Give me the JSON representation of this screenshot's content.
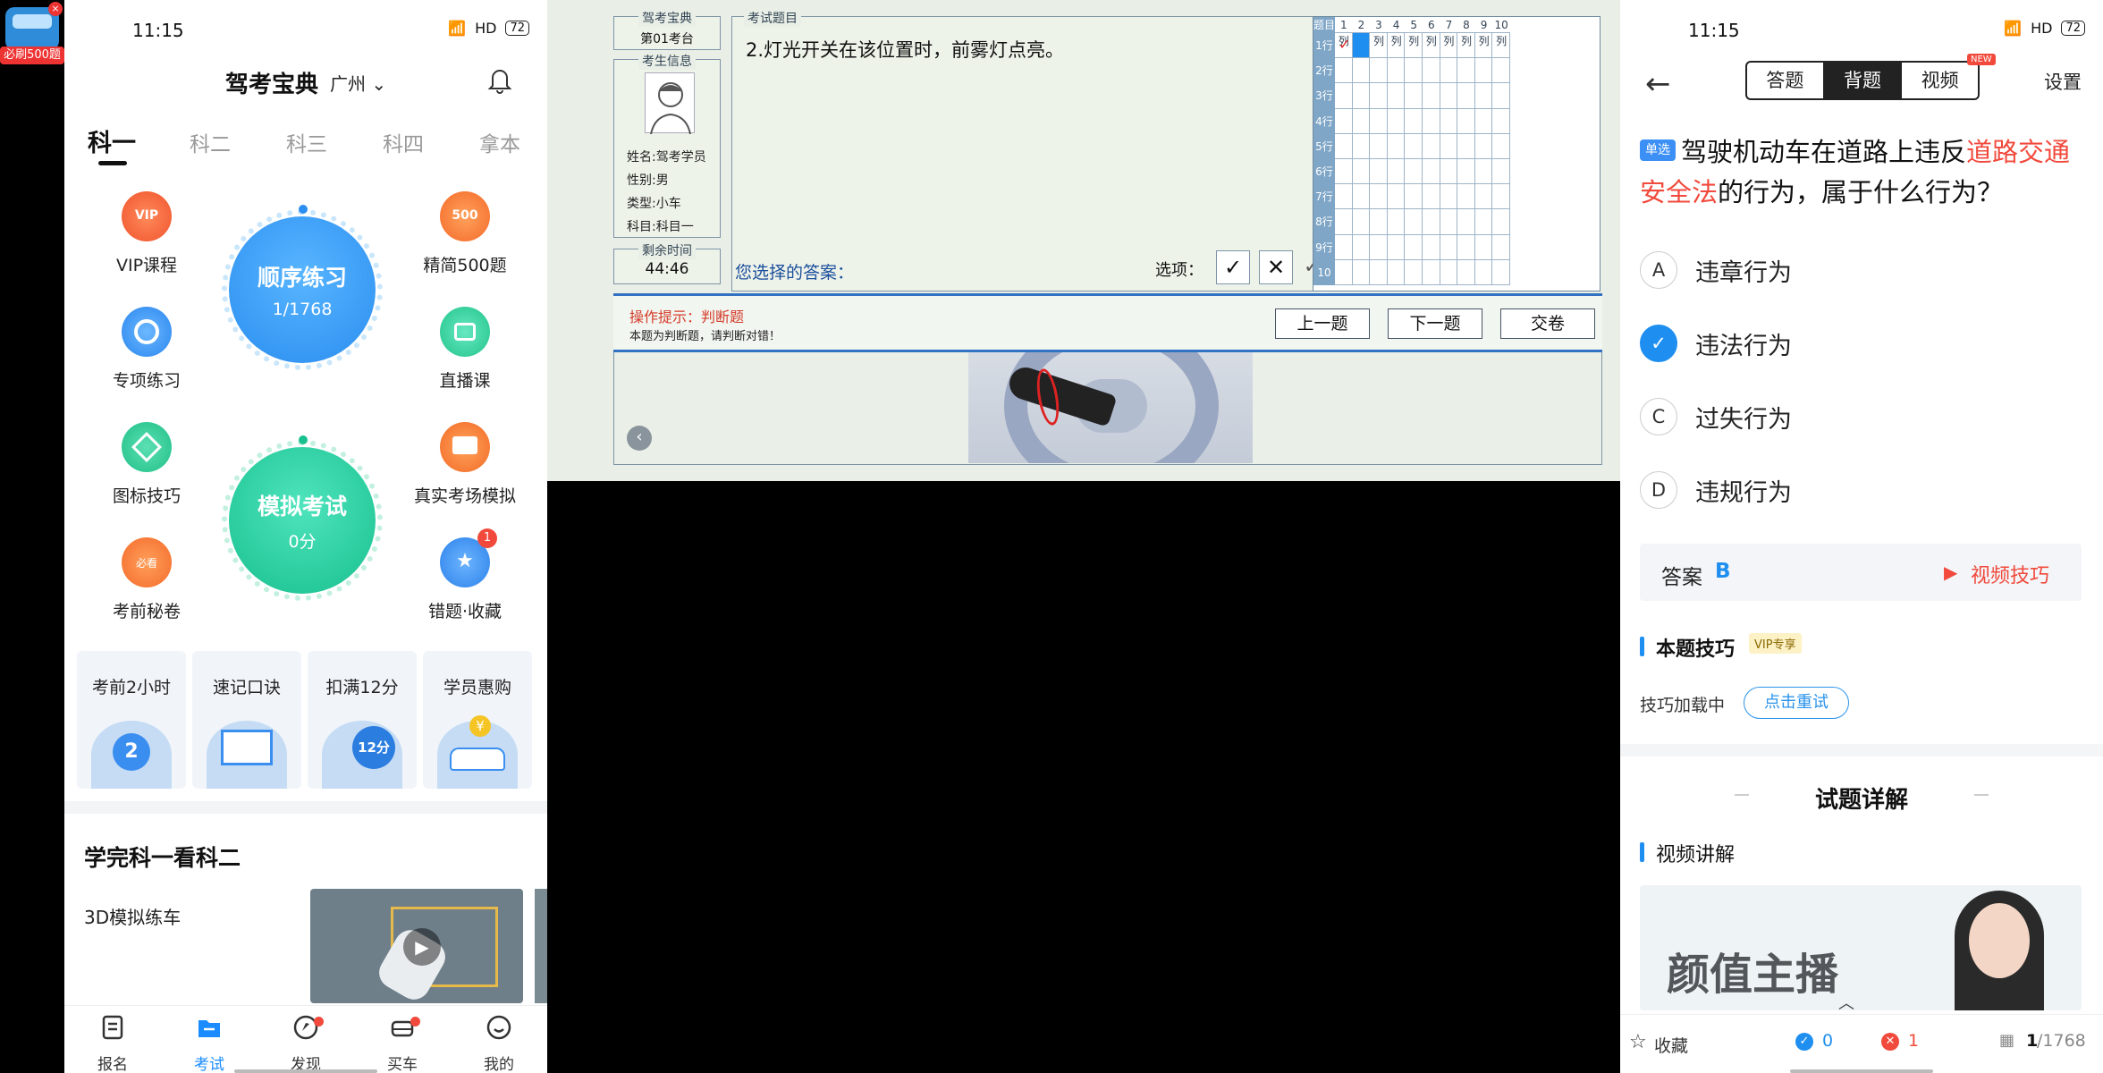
{
  "float_app": {
    "badge": "必刷500题"
  },
  "left": {
    "status": {
      "time": "11:15",
      "net": "HD",
      "battery": "72"
    },
    "header": {
      "title": "驾考宝典",
      "city": "广州"
    },
    "tabs": [
      "科一",
      "科二",
      "科三",
      "科四",
      "拿本"
    ],
    "features_left": [
      "VIP课程",
      "专项练习",
      "图标技巧",
      "考前秘卷"
    ],
    "features_right": [
      "精简500题",
      "直播课",
      "真实考场模拟",
      "错题·收藏"
    ],
    "vip_icon_text": "VIP",
    "icon_500_text": "500",
    "mijuan_icon_text": "必看",
    "wrong_badge": "1",
    "practice": {
      "title": "顺序练习",
      "progress": "1/1768",
      "progress_fraction": 0.0006
    },
    "mock": {
      "title": "模拟考试",
      "score": "0分"
    },
    "cards": [
      "考前2小时",
      "速记口诀",
      "扣满12分",
      "学员惠购"
    ],
    "card_icons": [
      "2",
      "",
      "12分",
      "¥"
    ],
    "section_title": "学完科一看科二",
    "section_item": "3D模拟练车",
    "nav": [
      "报名",
      "考试",
      "发现",
      "买车",
      "我的"
    ]
  },
  "exam": {
    "seat_label": "驾考宝典",
    "seat": "第01考台",
    "candidate_label": "考生信息",
    "name": "姓名:驾考学员",
    "gender": "性别:男",
    "type": "类型:小车",
    "subject": "科目:科目一",
    "time_label": "剩余时间",
    "time_left": "44:46",
    "question_label": "考试题目",
    "question": "2.灯光开关在该位置时，前雾灯点亮。",
    "answer_label": "您选择的答案：",
    "options_label": "选项：",
    "option_true": "✓",
    "option_false": "✕",
    "check_mark": "✓",
    "hint_title": "操作提示：判断题",
    "hint_body": "本题为判断题，请判断对错！",
    "btn_prev": "上一题",
    "btn_next": "下一题",
    "btn_submit": "交卷",
    "grid_corner": "题目",
    "grid_cols": [
      "1列",
      "2列",
      "3列",
      "4列",
      "5列",
      "6列",
      "7列",
      "8列",
      "9列",
      "10列"
    ],
    "grid_rows": [
      "1行",
      "2行",
      "3行",
      "4行",
      "5行",
      "6行",
      "7行",
      "8行",
      "9行",
      "10行"
    ],
    "grid_mark": "✓",
    "grid_current": {
      "row": 1,
      "col": 2
    }
  },
  "right": {
    "status": {
      "time": "11:15",
      "net": "HD",
      "battery": "72"
    },
    "segments": [
      "答题",
      "背题",
      "视频"
    ],
    "active_segment": "背题",
    "new_tag": "NEW",
    "settings": "设置",
    "question_tag": "单选",
    "question_parts": [
      "驾驶机动车在道路上违反",
      "道路交通安全法",
      "的行为，属于什么行为？"
    ],
    "choices": [
      {
        "key": "A",
        "text": "违章行为"
      },
      {
        "key": "B",
        "text": "违法行为",
        "selected": true
      },
      {
        "key": "C",
        "text": "过失行为"
      },
      {
        "key": "D",
        "text": "违规行为"
      }
    ],
    "answer_label": "答案",
    "answer_value": "B",
    "video_tip": "视频技巧",
    "skill_title": "本题技巧",
    "vip_tag": "VIP专享",
    "skill_loading": "技巧加载中",
    "retry": "点击重试",
    "detail_title": "试题详解",
    "video_explain": "视频讲解",
    "video_caption": "颜值主播",
    "bottom": {
      "favorite": "收藏",
      "correct": "0",
      "wrong": "1",
      "current": "1",
      "total": "/1768"
    },
    "colors": {
      "accent": "#1e8ff0",
      "red": "#f14a3c"
    }
  }
}
